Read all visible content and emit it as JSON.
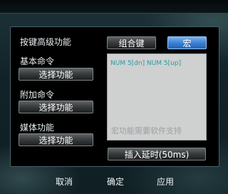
{
  "dialog": {
    "title": "按键高级功能",
    "tabs": {
      "combo": "组合键",
      "macro": "宏"
    }
  },
  "sections": [
    {
      "label": "基本命令",
      "button": "选择功能"
    },
    {
      "label": "附加命令",
      "button": "选择功能"
    },
    {
      "label": "媒体功能",
      "button": "选择功能"
    }
  ],
  "macro": {
    "content": "NUM 5[dn] NUM 5[up]",
    "hint": "宏功能需要软件支持",
    "insert_delay": "插入延时(50ms)"
  },
  "footer": {
    "cancel": "取消",
    "ok": "确定",
    "apply": "应用"
  },
  "colors": {
    "accent": "#3d82d6",
    "macro_text": "#2a9aa3"
  }
}
